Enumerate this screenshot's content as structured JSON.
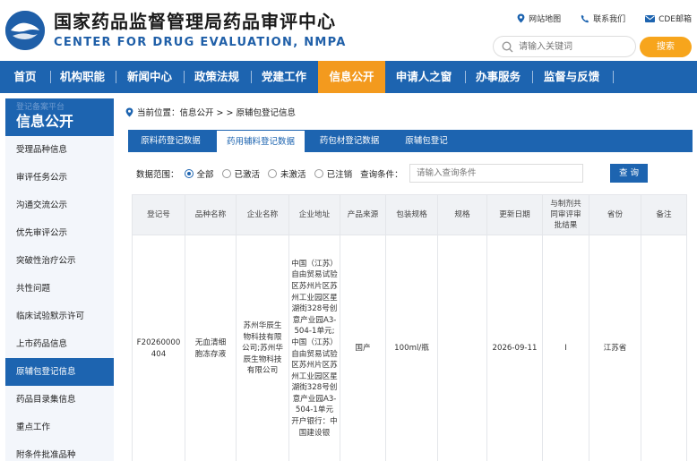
{
  "header": {
    "title_cn": "国家药品监督管理局药品审评中心",
    "title_en": "CENTER FOR DRUG EVALUATION, NMPA",
    "top_links": [
      {
        "label": "网站地图",
        "icon": "map-pin-icon"
      },
      {
        "label": "联系我们",
        "icon": "phone-icon"
      },
      {
        "label": "CDE邮箱",
        "icon": "mail-icon"
      }
    ],
    "search_placeholder": "请输入关键词",
    "search_button": "搜索"
  },
  "nav": {
    "items": [
      "首页",
      "机构职能",
      "新闻中心",
      "政策法规",
      "党建工作",
      "信息公开",
      "申请人之窗",
      "办事服务",
      "监督与反馈"
    ],
    "active": "信息公开"
  },
  "sidebar": {
    "ghost_text": "登记备案平台",
    "title": "信息公开",
    "items": [
      "受理品种信息",
      "审评任务公示",
      "沟通交流公示",
      "优先审评公示",
      "突破性治疗公示",
      "共性问题",
      "临床试验默示许可",
      "上市药品信息",
      "原辅包登记信息",
      "药品目录集信息",
      "重点工作",
      "附条件批准品种"
    ],
    "active": "原辅包登记信息"
  },
  "breadcrumb": {
    "label": "当前位置：信息公开 > > 原辅包登记信息"
  },
  "tabs": {
    "items": [
      "原料药登记数据",
      "药用辅料登记数据",
      "药包材登记数据",
      "原辅包登记"
    ],
    "active": "药用辅料登记数据"
  },
  "filter": {
    "scope_label": "数据范围：",
    "options": [
      "全部",
      "已激活",
      "未激活",
      "已注销"
    ],
    "selected": "全部",
    "condition_label": "查询条件：",
    "input_placeholder": "请输入查询条件",
    "query_button": "查 询"
  },
  "table": {
    "headers": [
      "登记号",
      "品种名称",
      "企业名称",
      "企业地址",
      "产品来源",
      "包装规格",
      "规格",
      "更新日期",
      "与制剂共同审评审批结果",
      "省份",
      "备注"
    ],
    "rows": [
      {
        "reg_no": "F20260000404",
        "name": "无血清细胞冻存液",
        "company": "苏州华辰生物科技有限公司;苏州华辰生物科技有限公司",
        "address": "中国（江苏）自由贸易试验区苏州片区苏州工业园区星湖街328号创意产业园A3-504-1单元;中国（江苏）自由贸易试验区苏州片区苏州工业园区星湖街328号创意产业园A3-504-1单元 开户银行：中国建设银",
        "source": "国产",
        "package": "100ml/瓶",
        "spec": "",
        "update_date": "2026-09-11",
        "review_result": "I",
        "province": "江苏省",
        "remark": ""
      }
    ]
  },
  "colors": {
    "primary": "#1d64b0",
    "accent": "#f39a1e",
    "search_button": "#f7a51c"
  }
}
